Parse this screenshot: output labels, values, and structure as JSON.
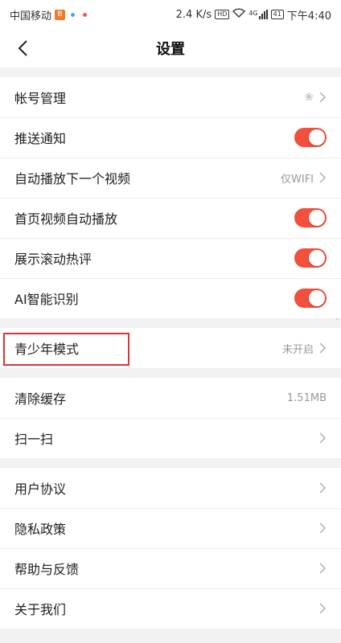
{
  "status_bar": {
    "carrier": "中国移动",
    "carrier_badge": "B",
    "speed": "2.4 K/s",
    "hd_badge": "HD",
    "signal_type": "4G",
    "battery": "41",
    "time": "下午4:40"
  },
  "header": {
    "title": "设置",
    "back_icon": "chevron-left-icon"
  },
  "groups": [
    {
      "items": [
        {
          "label": "帐号管理",
          "value": "",
          "control": "chevron",
          "icon": "paw-icon"
        },
        {
          "label": "推送通知",
          "control": "toggle",
          "on": true
        },
        {
          "label": "自动播放下一个视频",
          "value": "仅WIFI",
          "control": "chevron"
        },
        {
          "label": "首页视频自动播放",
          "control": "toggle",
          "on": true
        },
        {
          "label": "展示滚动热评",
          "control": "toggle",
          "on": true
        },
        {
          "label": "AI智能识别",
          "control": "toggle",
          "on": true
        }
      ]
    },
    {
      "items": [
        {
          "label": "青少年模式",
          "value": "未开启",
          "control": "chevron"
        }
      ]
    },
    {
      "items": [
        {
          "label": "清除缓存",
          "value": "1.51MB",
          "control": "text"
        },
        {
          "label": "扫一扫",
          "value": "",
          "control": "chevron"
        }
      ]
    },
    {
      "items": [
        {
          "label": "用户协议",
          "value": "",
          "control": "chevron"
        },
        {
          "label": "隐私政策",
          "value": "",
          "control": "chevron"
        },
        {
          "label": "帮助与反馈",
          "value": "",
          "control": "chevron"
        },
        {
          "label": "关于我们",
          "value": "",
          "control": "chevron"
        }
      ]
    }
  ],
  "colors": {
    "toggle_on": "#f0503c",
    "highlight_box": "#dd3333",
    "background": "#f2f2f2"
  }
}
